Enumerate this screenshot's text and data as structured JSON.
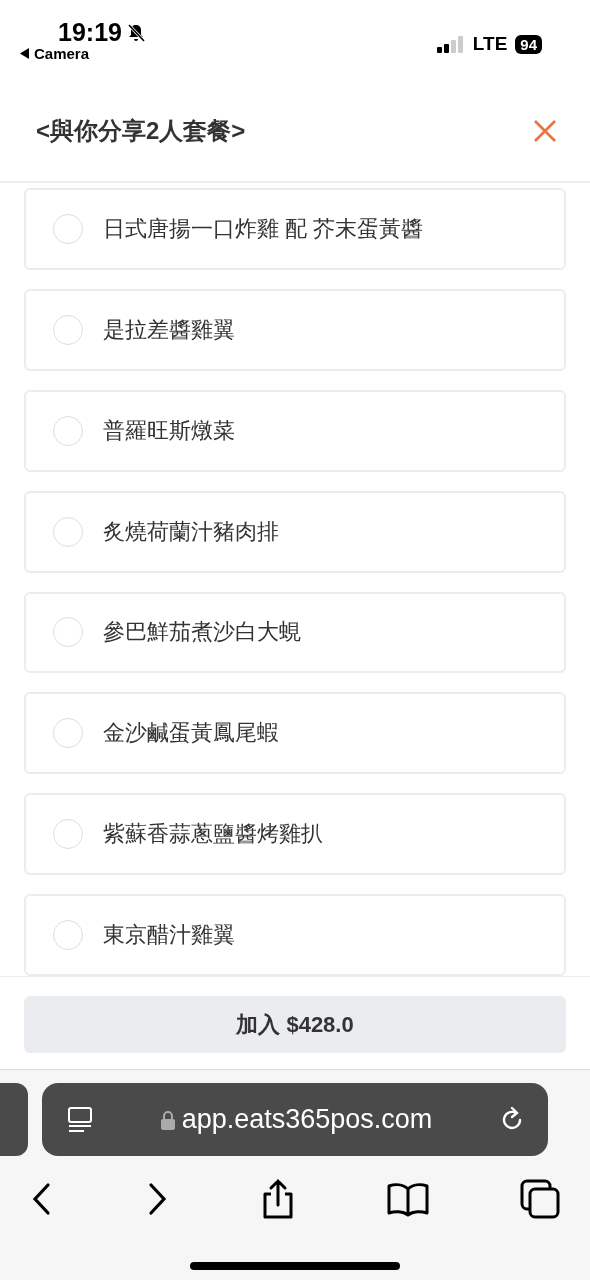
{
  "status_bar": {
    "time": "19:19",
    "back_app": "Camera",
    "network": "LTE",
    "battery": "94"
  },
  "header": {
    "title": "<與你分享2人套餐>"
  },
  "options": [
    {
      "label": "日式唐揚一口炸雞 配 芥末蛋黃醬",
      "selected": false
    },
    {
      "label": "是拉差醬雞翼",
      "selected": false
    },
    {
      "label": "普羅旺斯燉菜",
      "selected": false
    },
    {
      "label": "炙燒荷蘭汁豬肉排",
      "selected": false
    },
    {
      "label": "參巴鮮茄煮沙白大蜆",
      "selected": false
    },
    {
      "label": "金沙鹹蛋黃鳳尾蝦",
      "selected": false
    },
    {
      "label": "紫蘇香蒜蔥鹽醬烤雞扒",
      "selected": false
    },
    {
      "label": "東京醋汁雞翼",
      "selected": false
    }
  ],
  "add_button": {
    "label": "加入 $428.0"
  },
  "browser": {
    "url": "app.eats365pos.com"
  }
}
